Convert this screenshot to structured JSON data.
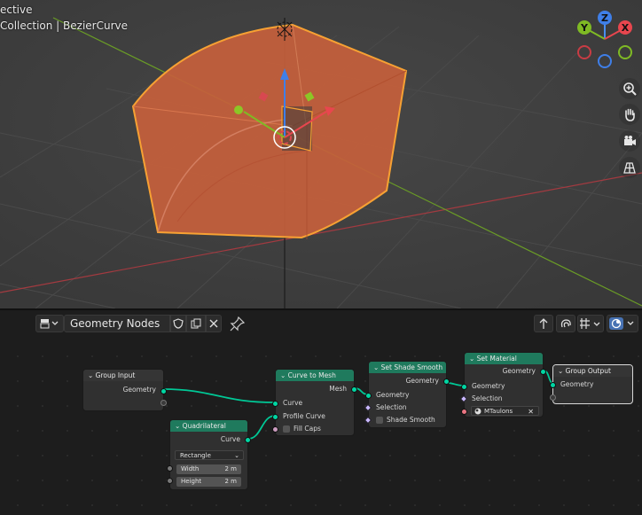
{
  "viewport": {
    "line1": "ective",
    "line2": "Collection | BezierCurve",
    "gizmo": {
      "x": "X",
      "y": "Y",
      "z": "Z"
    },
    "nav_buttons": [
      "zoom-icon",
      "hand-icon",
      "camera-icon",
      "grid-icon"
    ]
  },
  "header": {
    "editor_type_icon": "node-editor-icon",
    "nodetree_name": "Geometry Nodes"
  },
  "nodes": {
    "group_input": {
      "title": "Group Input",
      "out_geometry": "Geometry"
    },
    "quadrilateral": {
      "title": "Quadrilateral",
      "out_curve": "Curve",
      "mode": "Rectangle",
      "width_label": "Width",
      "width_value": "2 m",
      "height_label": "Height",
      "height_value": "2 m"
    },
    "curve_to_mesh": {
      "title": "Curve to Mesh",
      "out_mesh": "Mesh",
      "in_curve": "Curve",
      "in_profile": "Profile Curve",
      "fill_caps": "Fill Caps"
    },
    "set_shade_smooth": {
      "title": "Set Shade Smooth",
      "out_geometry": "Geometry",
      "in_geometry": "Geometry",
      "in_selection": "Selection",
      "shade_smooth": "Shade Smooth"
    },
    "set_material": {
      "title": "Set Material",
      "out_geometry": "Geometry",
      "in_geometry": "Geometry",
      "in_selection": "Selection",
      "material": "MTaulons"
    },
    "group_output": {
      "title": "Group Output",
      "in_geometry": "Geometry"
    }
  },
  "colors": {
    "geometry_socket": "#00d6a3",
    "node_header_geometry": "#1f7a5d",
    "selection_outline": "#f7a133",
    "object_fill": "#c8603c"
  }
}
